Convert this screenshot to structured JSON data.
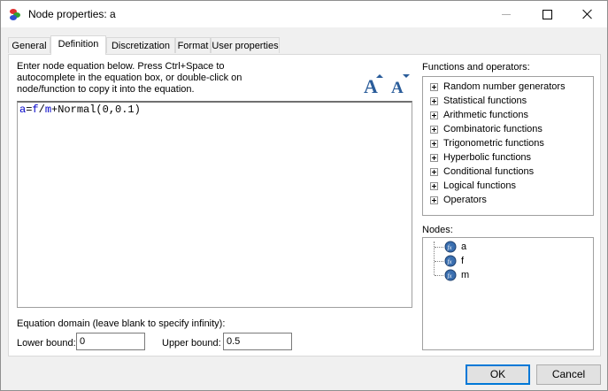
{
  "window": {
    "title": "Node properties: a"
  },
  "tabs": [
    {
      "label": "General"
    },
    {
      "label": "Definition"
    },
    {
      "label": "Discretization"
    },
    {
      "label": "Format"
    },
    {
      "label": "User properties"
    }
  ],
  "active_tab": "Definition",
  "definition": {
    "instructions": "Enter node equation below. Press Ctrl+Space to autocomplete in the equation box, or double-click on node/function to copy it into the equation.",
    "equation_parts": {
      "lhs": "a",
      "eq": "=",
      "f": "f",
      "slash": "/",
      "m": "m",
      "rest": "+Normal(0,0.1)"
    },
    "functions_label": "Functions and operators:",
    "functions": [
      "Random number generators",
      "Statistical functions",
      "Arithmetic functions",
      "Combinatoric functions",
      "Trigonometric functions",
      "Hyperbolic functions",
      "Conditional functions",
      "Logical functions",
      "Operators"
    ],
    "nodes_label": "Nodes:",
    "nodes": [
      "a",
      "f",
      "m"
    ],
    "domain_label": "Equation domain (leave blank to specify infinity):",
    "lower_bound_label": "Lower bound:",
    "lower_bound_value": "0",
    "upper_bound_label": "Upper bound:",
    "upper_bound_value": "0.5"
  },
  "buttons": {
    "ok": "OK",
    "cancel": "Cancel"
  },
  "colors": {
    "accent": "#0078d7",
    "equation_var": "#0000c8",
    "node_icon": "#3a6fb0"
  }
}
